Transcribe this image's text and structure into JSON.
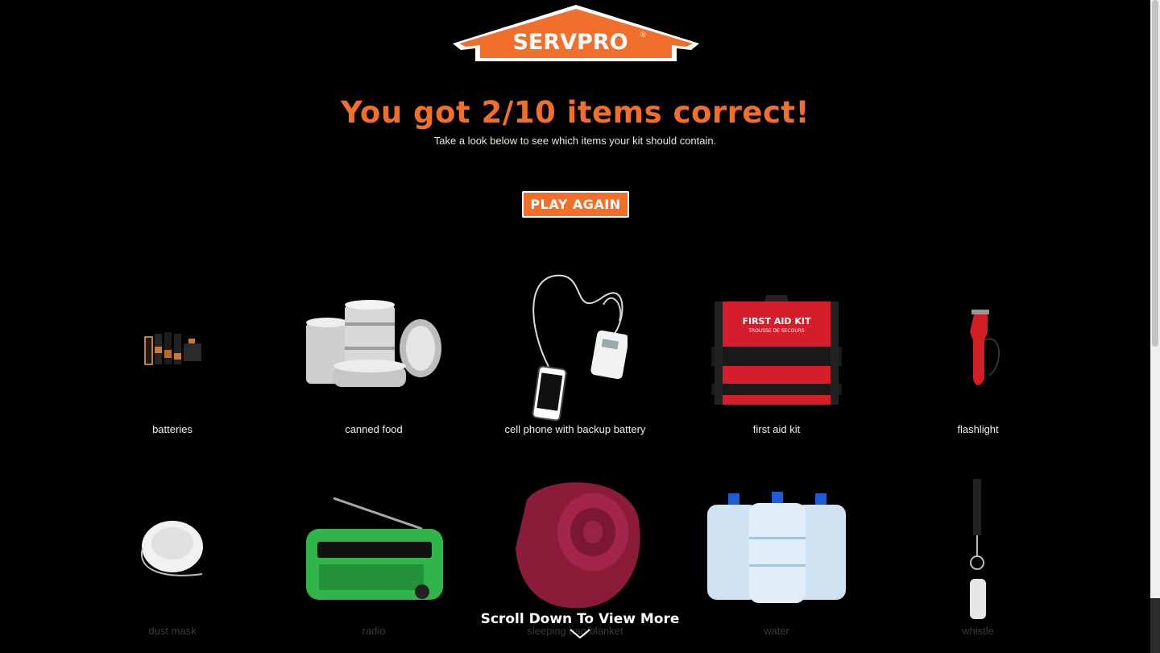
{
  "brand": {
    "logo_text": "SERVPRO",
    "registered": "®",
    "accent": "#f26f2b"
  },
  "result": {
    "headline": "You got 2/10 items correct!",
    "subtext": "Take a look below to see which items your kit should contain."
  },
  "actions": {
    "play_again": "PLAY AGAIN"
  },
  "items": [
    {
      "label": "batteries",
      "icon": "batteries-icon"
    },
    {
      "label": "canned food",
      "icon": "canned-food-icon"
    },
    {
      "label": "cell phone with backup battery",
      "icon": "cell-phone-icon"
    },
    {
      "label": "first aid kit",
      "icon": "first-aid-kit-icon",
      "kit_text": "FIRST AID KIT",
      "kit_subtext": "TROUSSE DE SECOURS"
    },
    {
      "label": "flashlight",
      "icon": "flashlight-icon"
    },
    {
      "label": "dust mask",
      "icon": "dust-mask-icon"
    },
    {
      "label": "radio",
      "icon": "radio-icon"
    },
    {
      "label": "sleeping bag/blanket",
      "icon": "sleeping-bag-icon"
    },
    {
      "label": "water",
      "icon": "water-jugs-icon"
    },
    {
      "label": "whistle",
      "icon": "whistle-icon"
    }
  ],
  "scroll_hint": "Scroll Down To View More"
}
